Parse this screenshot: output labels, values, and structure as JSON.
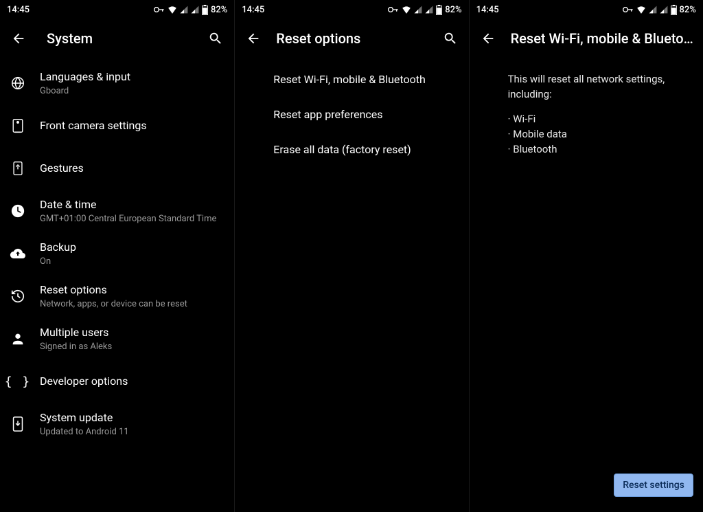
{
  "status": {
    "time": "14:45",
    "battery": "82%"
  },
  "pane1": {
    "title": "System",
    "items": [
      {
        "title": "Languages & input",
        "sub": "Gboard"
      },
      {
        "title": "Front camera settings",
        "sub": ""
      },
      {
        "title": "Gestures",
        "sub": ""
      },
      {
        "title": "Date & time",
        "sub": "GMT+01:00 Central European Standard Time"
      },
      {
        "title": "Backup",
        "sub": "On"
      },
      {
        "title": "Reset options",
        "sub": "Network, apps, or device can be reset"
      },
      {
        "title": "Multiple users",
        "sub": "Signed in as Aleks"
      },
      {
        "title": "Developer options",
        "sub": ""
      },
      {
        "title": "System update",
        "sub": "Updated to Android 11"
      }
    ]
  },
  "pane2": {
    "title": "Reset options",
    "items": [
      {
        "title": "Reset Wi-Fi, mobile & Bluetooth"
      },
      {
        "title": "Reset app preferences"
      },
      {
        "title": "Erase all data (factory reset)"
      }
    ]
  },
  "pane3": {
    "title": "Reset Wi-Fi, mobile & Blueto…",
    "description": "This will reset all network settings, including:",
    "bullets": [
      "Wi-Fi",
      "Mobile data",
      "Bluetooth"
    ],
    "button": "Reset settings"
  }
}
